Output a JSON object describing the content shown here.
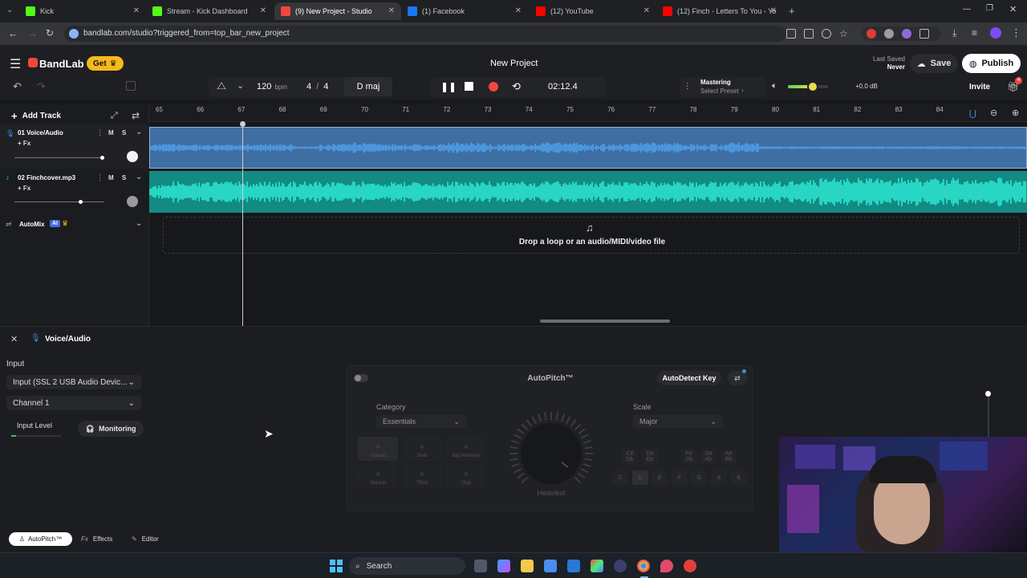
{
  "browser": {
    "tabs": [
      {
        "title": "Kick",
        "color": "#53fc18"
      },
      {
        "title": "Stream - Kick Dashboard",
        "color": "#53fc18"
      },
      {
        "title": "(9) New Project - Studio",
        "color": "#f0483e"
      },
      {
        "title": "(1) Facebook",
        "color": "#1877f2"
      },
      {
        "title": "(12) YouTube",
        "color": "#ff0000"
      },
      {
        "title": "(12) Finch - Letters To You - Yo",
        "color": "#ff0000"
      }
    ],
    "url": "bandlab.com/studio?triggered_from=top_bar_new_project"
  },
  "header": {
    "logo": "BandLab",
    "get_label": "Get",
    "project_title": "New Project",
    "last_saved_label": "Last Saved",
    "last_saved_value": "Never",
    "save_label": "Save",
    "publish_label": "Publish",
    "invite_label": "Invite",
    "notifications": "4",
    "tempo": "120",
    "tempo_unit": "bpm",
    "time_sig_top": "4",
    "time_sig_sep": "/",
    "time_sig_bottom": "4",
    "key": "D maj",
    "time": "02:12.4",
    "mastering_label": "Mastering",
    "mastering_preset": "Select Preset",
    "volume_db": "+0.0 dB",
    "volume_level": 0.62
  },
  "tracks": {
    "add_track_label": "Add Track",
    "items": [
      {
        "name": "01  Voice/Audio",
        "fx": "+ Fx",
        "m": "M",
        "s": "S",
        "color": "#3b8fe0"
      },
      {
        "name": "02  Finchcover.mp3",
        "fx": "+ Fx",
        "m": "M",
        "s": "S",
        "color": "#1ec9b7"
      }
    ],
    "automix_label": "AutoMix",
    "automix_badge": "AI",
    "drop_text": "Drop a loop or an audio/MIDI/video file"
  },
  "ruler": [
    "65",
    "66",
    "67",
    "68",
    "69",
    "70",
    "71",
    "72",
    "73",
    "74",
    "75",
    "76",
    "77",
    "78",
    "79",
    "80",
    "81",
    "82",
    "83",
    "84"
  ],
  "panel": {
    "track_name": "Voice/Audio",
    "input_heading": "Input",
    "input_device": "Input (SSL 2 USB Audio Devic...",
    "channel": "Channel 1",
    "input_level_label": "Input Level",
    "monitoring_label": "Monitoring",
    "autopitch_title": "AutoPitch™",
    "autodetect_label": "AutoDetect Key",
    "category_label": "Category",
    "category_value": "Essentials",
    "scale_label": "Scale",
    "scale_value": "Major",
    "effects": [
      {
        "name": "Classic"
      },
      {
        "name": "Duet"
      },
      {
        "name": "Big Harmony"
      },
      {
        "name": "Natural"
      },
      {
        "name": "Third"
      },
      {
        "name": "Chip"
      }
    ],
    "knob_label": "Heaviest",
    "keys_top": [
      "C#\nDb",
      "D#\nEb",
      "F#\nGb",
      "G#\nAb",
      "A#\nBb"
    ],
    "keys_bottom": [
      "C",
      "D",
      "E",
      "F",
      "G",
      "A",
      "B"
    ],
    "bottom_tabs": [
      "AutoPitch™",
      "Effects",
      "Editor"
    ],
    "tab_prefixes": [
      "",
      "Fx",
      ""
    ]
  },
  "taskbar": {
    "search_label": "Search"
  }
}
